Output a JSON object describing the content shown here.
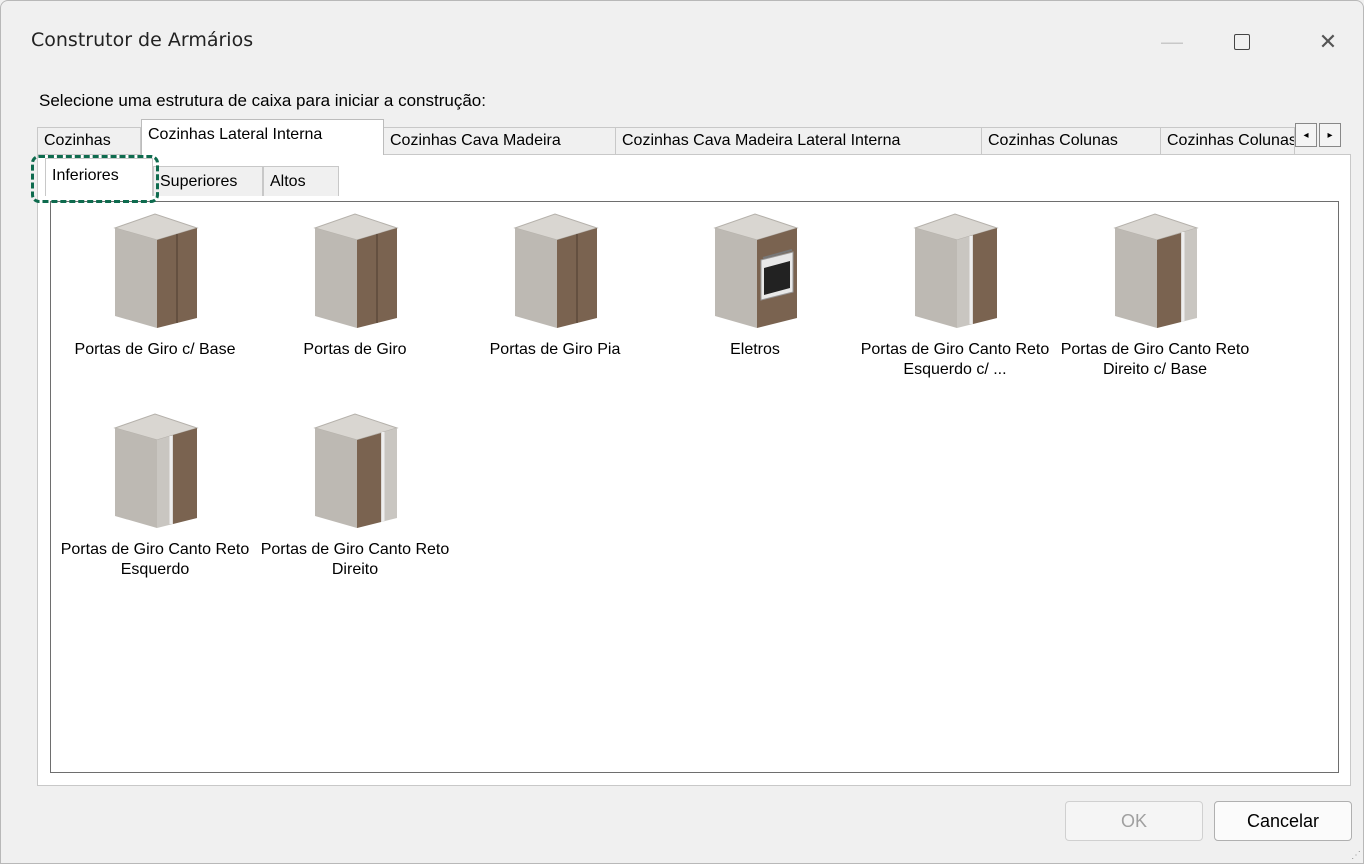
{
  "window": {
    "title": "Construtor de Armários",
    "minimize_label": "—",
    "close_label": "✕"
  },
  "prompt": "Selecione uma estrutura de caixa para iniciar a construção:",
  "tabs": [
    {
      "label": "Cozinhas"
    },
    {
      "label": "Cozinhas Lateral Interna"
    },
    {
      "label": "Cozinhas Cava Madeira"
    },
    {
      "label": "Cozinhas Cava Madeira Lateral Interna"
    },
    {
      "label": "Cozinhas Colunas"
    },
    {
      "label": "Cozinhas Colunas"
    }
  ],
  "active_tab": "Cozinhas Lateral Interna",
  "scroll": {
    "left": "◂",
    "right": "▸"
  },
  "subtabs": [
    {
      "label": "Inferiores"
    },
    {
      "label": "Superiores"
    },
    {
      "label": "Altos"
    }
  ],
  "active_subtab": "Inferiores",
  "items": [
    {
      "label": "Portas de Giro c/ Base",
      "icon": "cabinet-doors-icon"
    },
    {
      "label": "Portas de Giro",
      "icon": "cabinet-doors-icon"
    },
    {
      "label": "Portas de Giro Pia",
      "icon": "cabinet-doors-icon"
    },
    {
      "label": "Eletros",
      "icon": "oven-cabinet-icon"
    },
    {
      "label": "Portas de Giro Canto Reto Esquerdo c/ ...",
      "icon": "corner-cabinet-left-icon"
    },
    {
      "label": "Portas de Giro Canto Reto Direito c/ Base",
      "icon": "corner-cabinet-right-icon"
    },
    {
      "label": "Portas de Giro Canto Reto Esquerdo",
      "icon": "corner-cabinet-left-icon"
    },
    {
      "label": "Portas de Giro Canto Reto Direito",
      "icon": "corner-cabinet-right-icon"
    }
  ],
  "buttons": {
    "ok": "OK",
    "cancel": "Cancelar"
  },
  "colors": {
    "accent_highlight": "#0e6b4e",
    "wood": "#7a6350",
    "carcass": "#b8b4ae"
  }
}
